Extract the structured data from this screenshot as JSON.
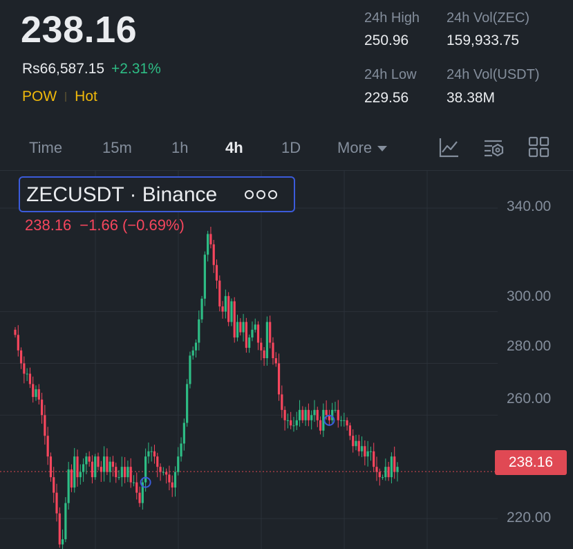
{
  "ticker": {
    "last_price": "238.16",
    "fiat_price": "Rs66,587.15",
    "change_pct": "+2.31%",
    "tags": [
      "POW",
      "Hot"
    ]
  },
  "stats": {
    "high_label": "24h High",
    "high_value": "250.96",
    "vol_base_label": "24h Vol(ZEC)",
    "vol_base_value": "159,933.75",
    "low_label": "24h Low",
    "low_value": "229.56",
    "vol_quote_label": "24h Vol(USDT)",
    "vol_quote_value": "38.38M"
  },
  "tabs": [
    {
      "label": "Time"
    },
    {
      "label": "15m"
    },
    {
      "label": "1h"
    },
    {
      "label": "4h",
      "active": true
    },
    {
      "label": "1D"
    },
    {
      "label": "More"
    }
  ],
  "tools": [
    "indicator-chart-icon",
    "settings-chart-icon",
    "grid-layout-icon"
  ],
  "legend": {
    "symbol": "ZECUSDT · Binance",
    "last": "238.16",
    "change": "−1.66",
    "change_pct": "(−0.69%)"
  },
  "y_axis_labels": [
    "340.00",
    "300.00",
    "280.00",
    "260.00",
    "238.16",
    "220.00"
  ],
  "colors": {
    "up": "#2ebd85",
    "down": "#f6465d",
    "accent": "#f0b90b",
    "background": "#1e2329",
    "marker": "#3b5bdb"
  },
  "chart_data": {
    "type": "candlestick",
    "interval": "4h",
    "current_price": 238.16,
    "y_ticks": [
      340,
      300,
      280,
      260,
      220
    ],
    "ylim": [
      212,
      352
    ],
    "grid": true,
    "closes": [
      291,
      285,
      280,
      276,
      276,
      272,
      267,
      270,
      266,
      260,
      252,
      244,
      236,
      230,
      222,
      210,
      212,
      226,
      239,
      232,
      244,
      236,
      238,
      241,
      244,
      242,
      236,
      244,
      240,
      238,
      244,
      238,
      242,
      240,
      236,
      236,
      240,
      236,
      240,
      234,
      234,
      230,
      226,
      234,
      244,
      246,
      246,
      244,
      240,
      238,
      238,
      237,
      234,
      232,
      238,
      244,
      249,
      257,
      272,
      283,
      285,
      288,
      297,
      305,
      322,
      330,
      326,
      318,
      312,
      302,
      300,
      306,
      296,
      304,
      290,
      296,
      292,
      296,
      286,
      290,
      293,
      295,
      288,
      285,
      282,
      296,
      288,
      282,
      280,
      268,
      262,
      258,
      258,
      256,
      256,
      258,
      262,
      258,
      262,
      258,
      260,
      262,
      258,
      254,
      262,
      260,
      258,
      262,
      262,
      258,
      258,
      258,
      256,
      252,
      248,
      250,
      246,
      248,
      244,
      246,
      246,
      240,
      238,
      236,
      236,
      240,
      236,
      244,
      238,
      240
    ],
    "markers": [
      {
        "index": 44,
        "price": 234
      },
      {
        "index": 106,
        "price": 258
      }
    ]
  }
}
